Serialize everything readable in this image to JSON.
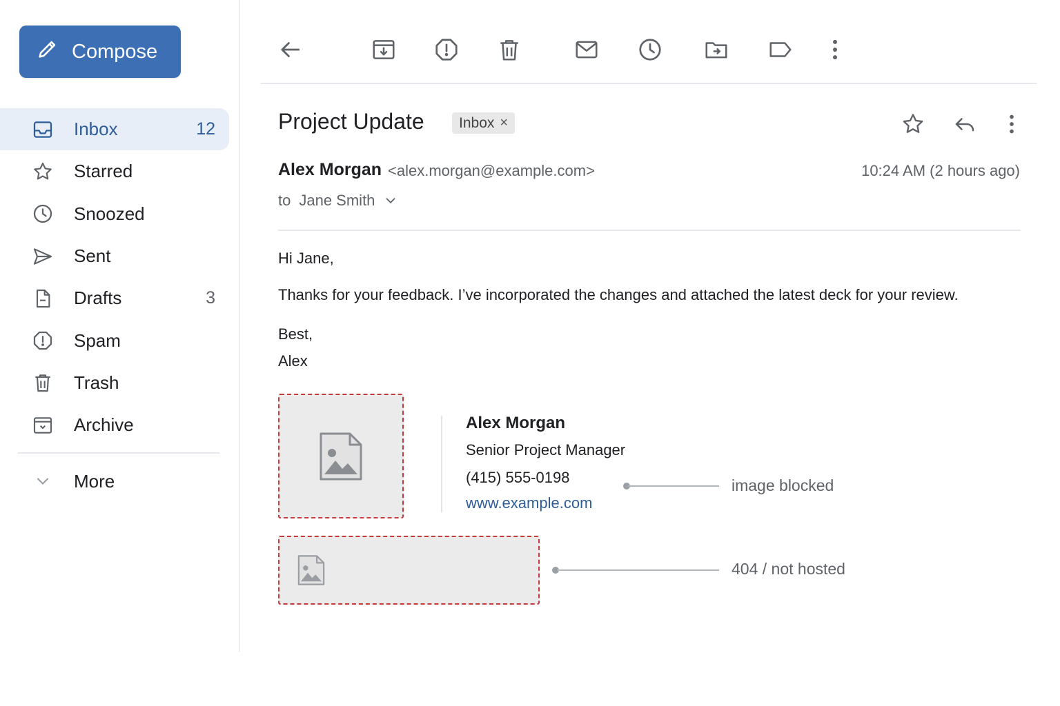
{
  "compose": {
    "label": "Compose"
  },
  "sidebar": {
    "items": [
      {
        "label": "Inbox",
        "count": "12",
        "icon": "inbox-icon"
      },
      {
        "label": "Starred",
        "count": "",
        "icon": "star-icon"
      },
      {
        "label": "Snoozed",
        "count": "",
        "icon": "clock-icon"
      },
      {
        "label": "Sent",
        "count": "",
        "icon": "send-icon"
      },
      {
        "label": "Drafts",
        "count": "3",
        "icon": "draft-icon"
      },
      {
        "label": "Spam",
        "count": "",
        "icon": "spam-icon"
      },
      {
        "label": "Trash",
        "count": "",
        "icon": "trash-icon"
      },
      {
        "label": "Archive",
        "count": "",
        "icon": "archive-icon"
      }
    ],
    "more": "More"
  },
  "message": {
    "subject": "Project Update",
    "label_chip": "Inbox",
    "label_chip_close": "×",
    "sender_name": "Alex Morgan",
    "sender_email": "<alex.morgan@example.com>",
    "time": "10:24 AM (2 hours ago)",
    "to_prefix": "to",
    "to_name": "Jane Smith",
    "body": {
      "greeting": "Hi Jane,",
      "paragraph": "Thanks for your feedback. I’ve incorporated the changes and attached the latest deck for your review.",
      "closing": "Best,",
      "signoff": "Alex"
    }
  },
  "signature": {
    "name": "Alex Morgan",
    "title": "Senior Project Manager",
    "phone": "(415) 555-0198",
    "website": "www.example.com",
    "callout_blocked": "image blocked",
    "callout_404": "404 / not hosted"
  },
  "colors": {
    "accent": "#3d6fb5",
    "active_nav_bg": "#e8eef8",
    "broken_image_border": "#c43b3b",
    "link": "#2f5d99"
  }
}
